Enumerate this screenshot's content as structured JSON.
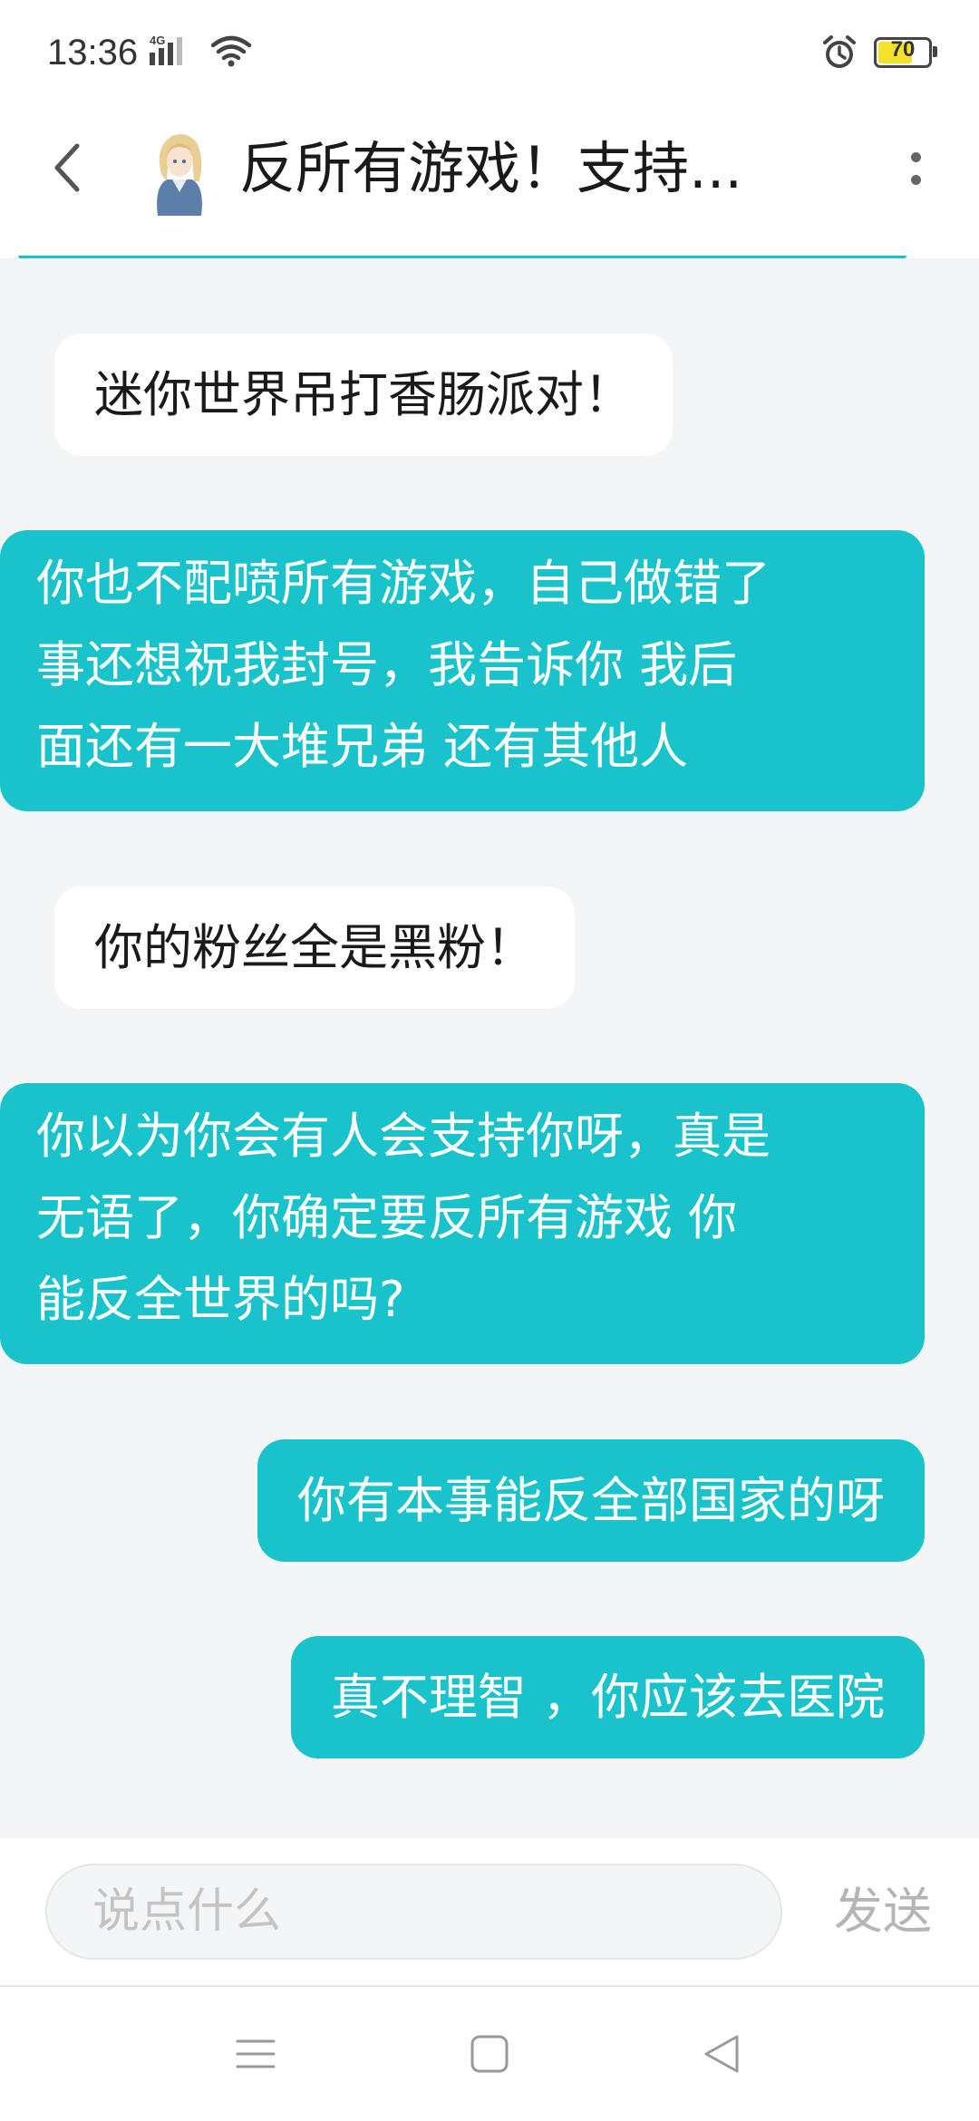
{
  "status_bar": {
    "time": "13:36",
    "network": "4G",
    "battery": "70",
    "battery_percent": 70
  },
  "header": {
    "title": "反所有游戏！支持...",
    "icons": {
      "back": "chevron-left-icon",
      "more": "more-vertical-icon"
    }
  },
  "messages": [
    {
      "side": "incoming",
      "text": "迷你世界吊打香肠派对！"
    },
    {
      "side": "outgoing",
      "lines": [
        "你也不配喷所有游戏，自己做错了",
        "事还想祝我封号，我告诉你 我后",
        "面还有一大堆兄弟 还有其他人"
      ]
    },
    {
      "side": "incoming",
      "text": "你的粉丝全是黑粉！"
    },
    {
      "side": "outgoing",
      "lines": [
        "你以为你会有人会支持你呀，真是",
        "无语了，你确定要反所有游戏 你",
        "能反全世界的吗?"
      ]
    },
    {
      "side": "outgoing",
      "text": "你有本事能反全部国家的呀"
    },
    {
      "side": "outgoing",
      "text": "真不理智 ，你应该去医院"
    }
  ],
  "input": {
    "placeholder": "说点什么",
    "send_label": "发送"
  },
  "colors": {
    "accent": "#18c3cc",
    "chat_background": "#f3f5f7",
    "incoming_bubble": "#ffffff"
  }
}
